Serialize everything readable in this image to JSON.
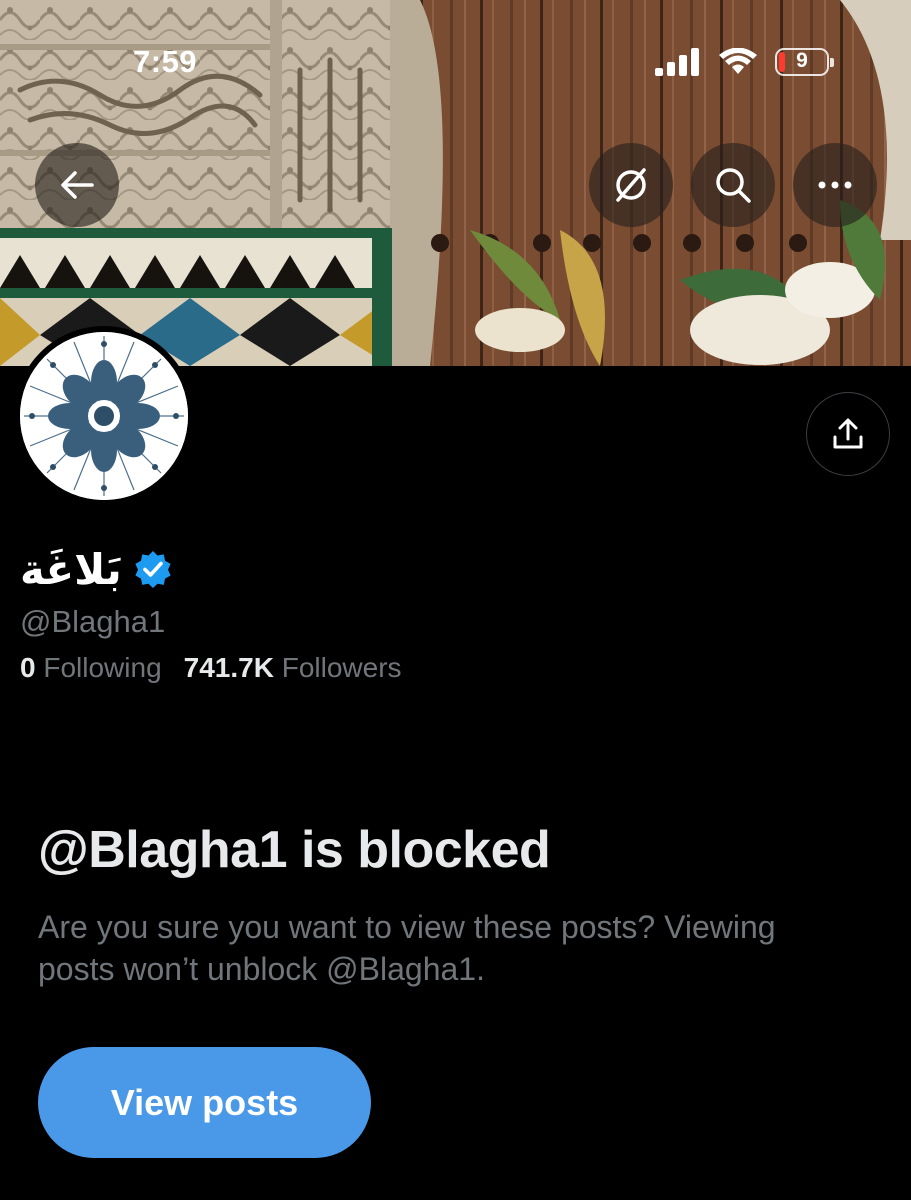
{
  "status_bar": {
    "time": "7:59",
    "battery_level": "9"
  },
  "profile": {
    "display_name": "بَلاغَة",
    "handle": "@Blagha1",
    "following_count": "0",
    "following_label": "Following",
    "followers_count": "741.7K",
    "followers_label": "Followers"
  },
  "blocked_notice": {
    "title": "@Blagha1 is blocked",
    "description": "Are you sure you want to view these posts? Viewing posts won’t unblock @Blagha1.",
    "button_label": "View posts"
  },
  "colors": {
    "accent": "#4a99e9",
    "verified_badge": "#1d9bf0",
    "muted_text": "#71767b",
    "battery_low": "#ff3b30"
  },
  "icons": {
    "back": "arrow-left-icon",
    "grok": "grok-slash-circle-icon",
    "search": "search-icon",
    "more": "more-dots-icon",
    "share": "share-upload-icon",
    "verified": "verified-badge-icon"
  }
}
